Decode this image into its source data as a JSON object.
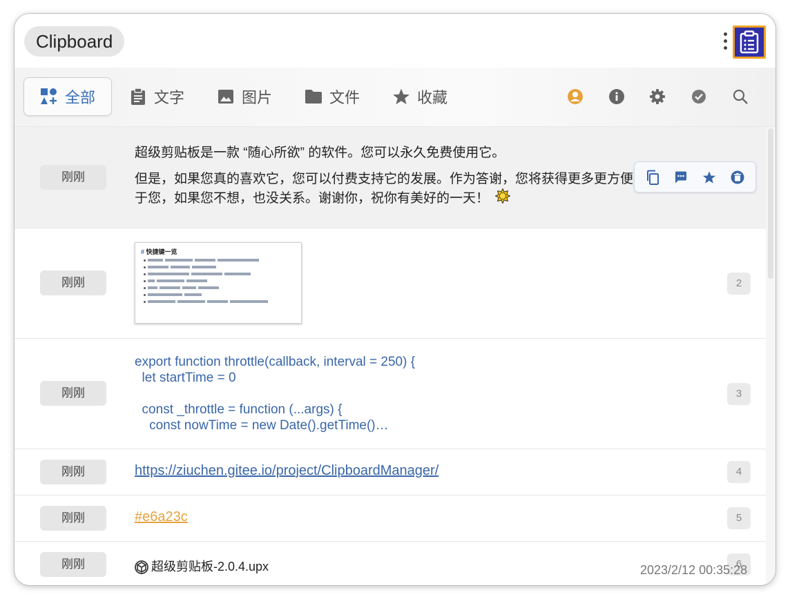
{
  "app": {
    "title": "Clipboard"
  },
  "tabs": [
    {
      "label": "全部",
      "icon": "shapes-icon",
      "active": true
    },
    {
      "label": "文字",
      "icon": "clipboard-text-icon"
    },
    {
      "label": "图片",
      "icon": "image-icon"
    },
    {
      "label": "文件",
      "icon": "folder-icon"
    },
    {
      "label": "收藏",
      "icon": "star-icon"
    }
  ],
  "toolbar": [
    "user-icon",
    "info-icon",
    "gear-icon",
    "check-badge-icon",
    "search-icon"
  ],
  "colors": {
    "accent": "#3966a8",
    "user_icon": "#e6a23c",
    "badge_bg": "#e6e6e6",
    "app_icon_bg": "#2f2fa8",
    "app_icon_border": "#f0a020"
  },
  "items": [
    {
      "time": "刚刚",
      "line1": "超级剪贴板是一款 “随心所欲” 的软件。您可以永久免费使用它。",
      "line2": "但是，如果您真的喜欢它，您可以付费支持它的发展。作为答谢，您将获得更多更方便",
      "line3": "于您，如果您不想，也没关系。谢谢你，祝你有美好的一天！"
    },
    {
      "time": "刚刚",
      "num": "2",
      "thumb_title_hash": "#",
      "thumb_title": "快捷键一览"
    },
    {
      "time": "刚刚",
      "num": "3",
      "code": "export function throttle(callback, interval = 250) {\n  let startTime = 0\n\n  const _throttle = function (...args) {\n    const nowTime = new Date().getTime()…"
    },
    {
      "time": "刚刚",
      "num": "4",
      "text": "https://ziuchen.gitee.io/project/ClipboardManager/"
    },
    {
      "time": "刚刚",
      "num": "5",
      "text": "#e6a23c"
    },
    {
      "time": "刚刚",
      "num": "6",
      "text": "超级剪贴板-2.0.4.upx"
    }
  ],
  "action_bar": [
    "copy-icon",
    "comment-icon",
    "star-icon",
    "delete-icon"
  ],
  "status": {
    "timestamp": "2023/2/12 00:35:28"
  }
}
